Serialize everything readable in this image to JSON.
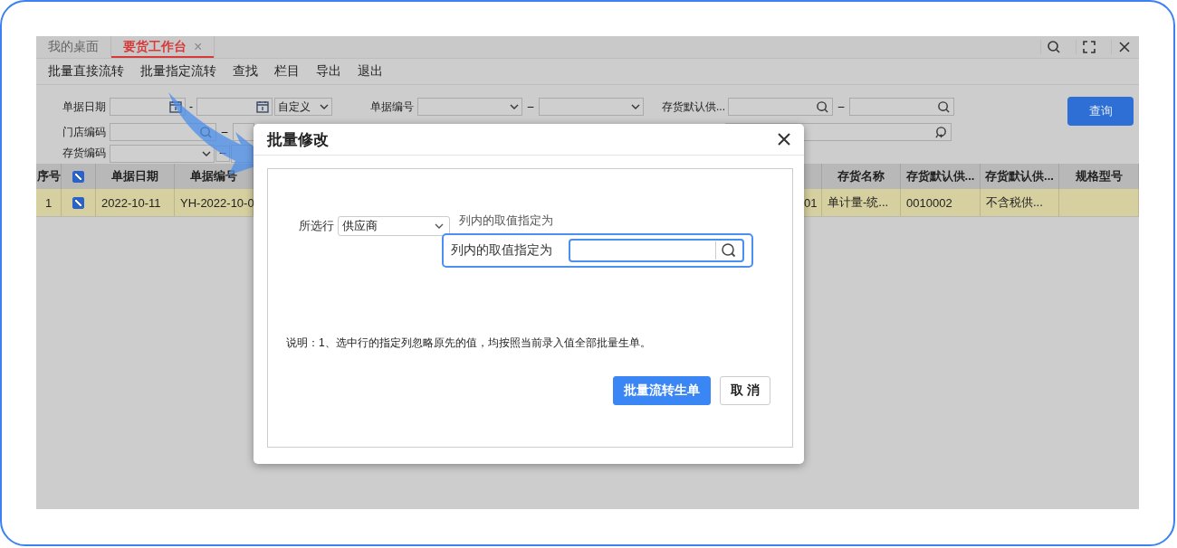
{
  "tabs": [
    {
      "label": "我的桌面",
      "selected": false,
      "closable": false
    },
    {
      "label": "要货工作台",
      "selected": true,
      "closable": true
    }
  ],
  "close_glyph": "×",
  "toolbar": [
    "批量直接流转",
    "批量指定流转",
    "查找",
    "栏目",
    "导出",
    "退出"
  ],
  "filters": {
    "doc_date": {
      "label": "单据日期",
      "separator": "-",
      "range_mode": "自定义"
    },
    "doc_no": {
      "label": "单据编号",
      "separator": "–"
    },
    "supplier": {
      "label": "存货默认供...",
      "separator": "–"
    },
    "store": {
      "label": "门店编码",
      "separator": "–"
    },
    "item": {
      "label": "存货编码",
      "separator": "–"
    }
  },
  "query_button": "查询",
  "table": {
    "columns": [
      {
        "label": "序号"
      },
      {
        "kind": "check",
        "checked": true
      },
      {
        "label": "单据日期"
      },
      {
        "label": "单据编号"
      },
      {},
      {
        "label": "存货名称"
      },
      {
        "label": "存货默认供..."
      },
      {
        "label": "存货默认供..."
      },
      {
        "label": "规格型号"
      }
    ],
    "rows": [
      {
        "selected": true,
        "checked": true,
        "cells": [
          "1",
          "",
          "2022-10-11",
          "YH-2022-10-0",
          "01",
          "单计量-统...",
          "0010002",
          "不含税供...",
          ""
        ]
      }
    ]
  },
  "dialog": {
    "title": "批量修改",
    "row_label": "所选行",
    "column_value": "供应商",
    "value_label": "列内的取值指定为",
    "note": "说明：1、选中行的指定列忽略原先的值，均按照当前录入值全部批量生单。",
    "buttons": [
      {
        "label": "批量流转生单",
        "kind": "primary"
      },
      {
        "label": "取 消",
        "kind": "default"
      }
    ]
  },
  "callout": {
    "label": "列内的取值指定为"
  }
}
